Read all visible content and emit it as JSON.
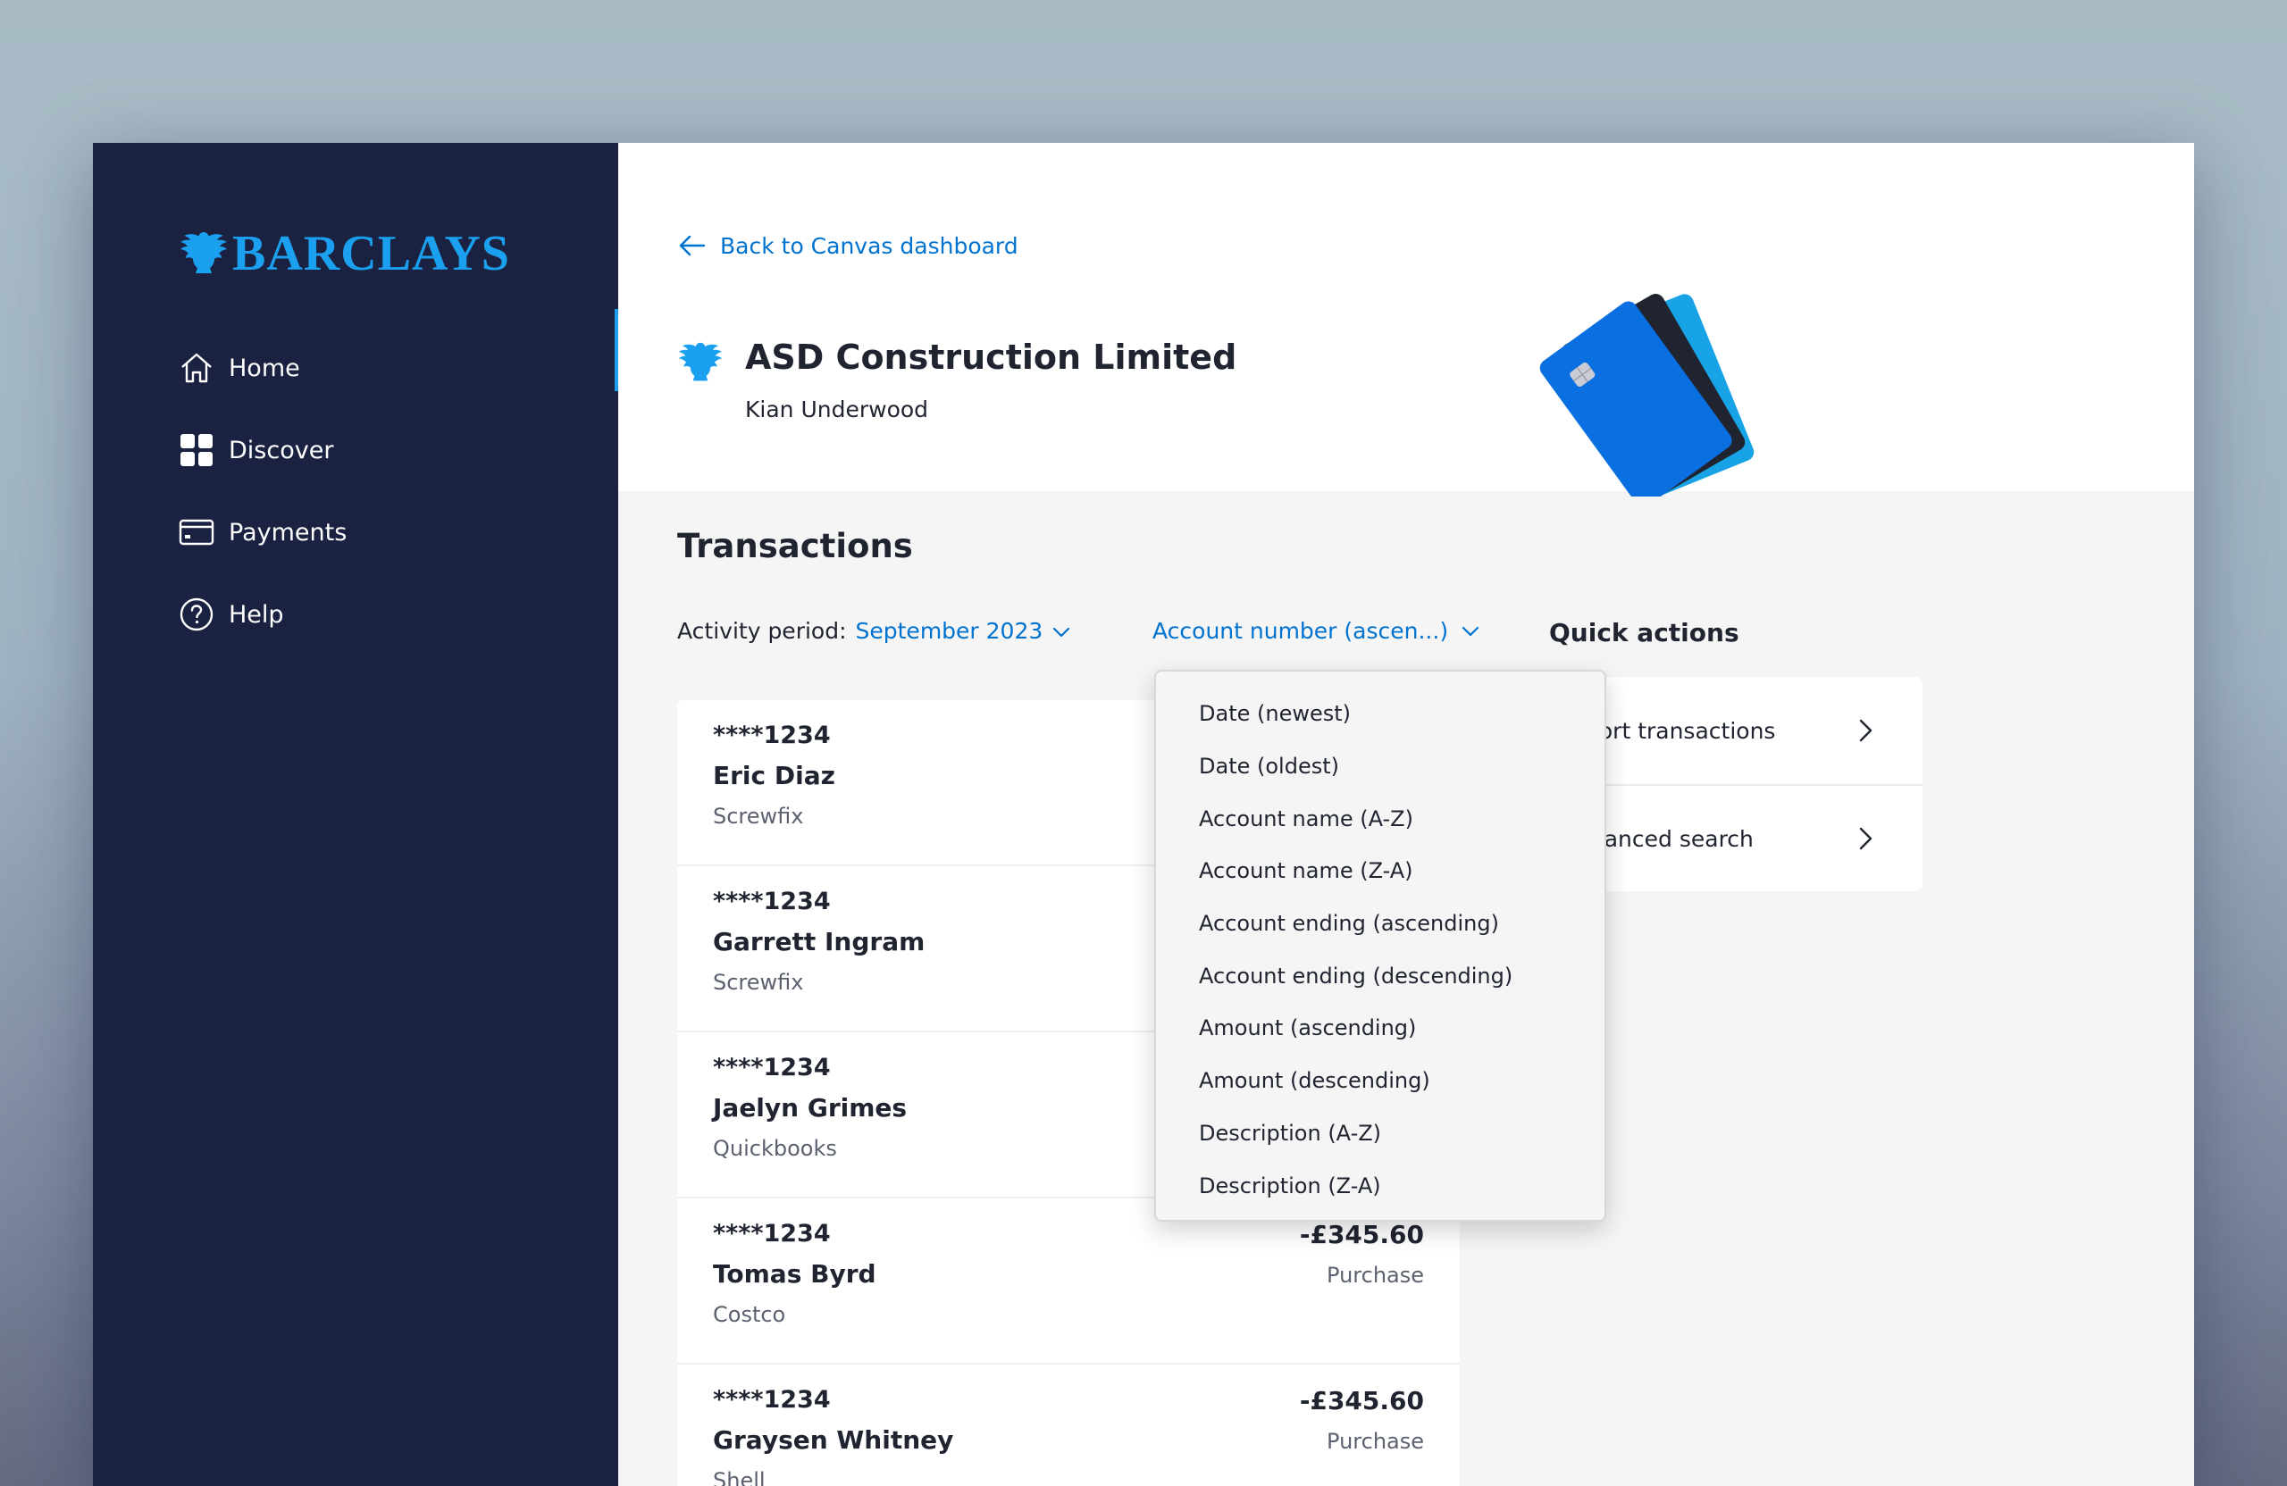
{
  "brand": {
    "name": "BARCLAYS",
    "color": "#1aa0ef",
    "sidebar_bg": "#1b2141",
    "link_color": "#0072d0"
  },
  "sidebar": {
    "items": [
      {
        "label": "Home",
        "icon": "home-icon"
      },
      {
        "label": "Discover",
        "icon": "grid-icon"
      },
      {
        "label": "Payments",
        "icon": "card-icon"
      },
      {
        "label": "Help",
        "icon": "help-icon"
      }
    ]
  },
  "header": {
    "back_label": "Back to Canvas dashboard",
    "company_name": "ASD Construction Limited",
    "user_name": "Kian Underwood"
  },
  "transactions": {
    "title": "Transactions",
    "activity_label": "Activity period:",
    "activity_value": "September 2023",
    "sort_value": "Account number (ascen...)",
    "rows": [
      {
        "account": "****1234",
        "name": "Eric Diaz",
        "merchant": "Screwfix",
        "amount": "",
        "type": ""
      },
      {
        "account": "****1234",
        "name": "Garrett Ingram",
        "merchant": "Screwfix",
        "amount": "",
        "type": ""
      },
      {
        "account": "****1234",
        "name": "Jaelyn Grimes",
        "merchant": "Quickbooks",
        "amount": "",
        "type": ""
      },
      {
        "account": "****1234",
        "name": "Tomas Byrd",
        "merchant": "Costco",
        "amount": "-£345.60",
        "type": "Purchase"
      },
      {
        "account": "****1234",
        "name": "Graysen Whitney",
        "merchant": "Shell",
        "amount": "-£345.60",
        "type": "Purchase"
      }
    ]
  },
  "sort_dropdown": {
    "options": [
      "Date (newest)",
      "Date (oldest)",
      "Account name (A-Z)",
      "Account name (Z-A)",
      "Account ending (ascending)",
      "Account ending (descending)",
      "Amount (ascending)",
      "Amount (descending)",
      "Description (A-Z)",
      "Description (Z-A)"
    ]
  },
  "quick_actions": {
    "title": "Quick actions",
    "items": [
      {
        "label": "port transactions"
      },
      {
        "label": "lvanced search"
      }
    ]
  }
}
